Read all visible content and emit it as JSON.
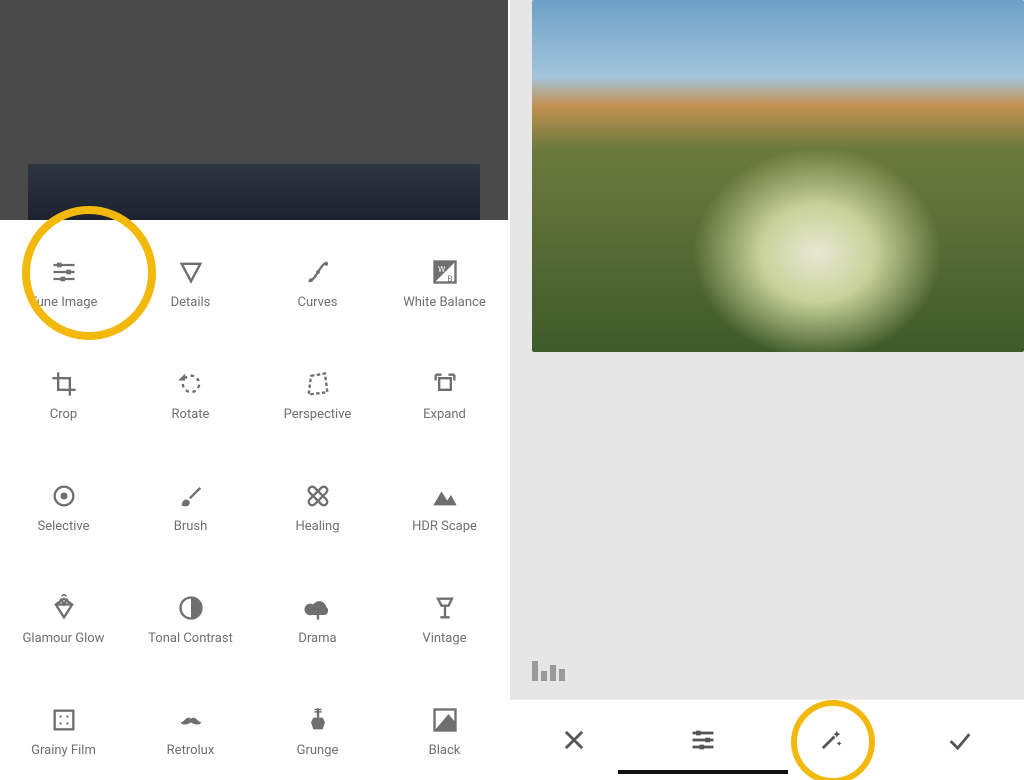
{
  "annotations": {
    "halo_color": "#f2b90c",
    "left_highlighted_tool": "tune-image",
    "right_highlighted_button": "magic-wand"
  },
  "left_pane": {
    "preview": {
      "description": "dark landscape photo preview"
    },
    "tools": [
      {
        "id": "tune-image",
        "label": "Tune Image",
        "icon": "sliders"
      },
      {
        "id": "details",
        "label": "Details",
        "icon": "triangle-down"
      },
      {
        "id": "curves",
        "label": "Curves",
        "icon": "curves"
      },
      {
        "id": "white-balance",
        "label": "White Balance",
        "icon": "wb"
      },
      {
        "id": "crop",
        "label": "Crop",
        "icon": "crop"
      },
      {
        "id": "rotate",
        "label": "Rotate",
        "icon": "rotate"
      },
      {
        "id": "perspective",
        "label": "Perspective",
        "icon": "perspective"
      },
      {
        "id": "expand",
        "label": "Expand",
        "icon": "expand"
      },
      {
        "id": "selective",
        "label": "Selective",
        "icon": "target"
      },
      {
        "id": "brush",
        "label": "Brush",
        "icon": "brush"
      },
      {
        "id": "healing",
        "label": "Healing",
        "icon": "bandage"
      },
      {
        "id": "hdr-scape",
        "label": "HDR Scape",
        "icon": "mountains"
      },
      {
        "id": "glamour-glow",
        "label": "Glamour Glow",
        "icon": "diamond"
      },
      {
        "id": "tonal-contrast",
        "label": "Tonal Contrast",
        "icon": "half-circle"
      },
      {
        "id": "drama",
        "label": "Drama",
        "icon": "cloud"
      },
      {
        "id": "vintage",
        "label": "Vintage",
        "icon": "lamp"
      },
      {
        "id": "grainy-film",
        "label": "Grainy Film",
        "icon": "film"
      },
      {
        "id": "retrolux",
        "label": "Retrolux",
        "icon": "mustache"
      },
      {
        "id": "grunge",
        "label": "Grunge",
        "icon": "guitar"
      },
      {
        "id": "black",
        "label": "Black",
        "icon": "bw"
      }
    ]
  },
  "right_pane": {
    "photo": {
      "description": "flower macro with mountains and sky"
    },
    "histogram_icon": true,
    "toolbar": [
      {
        "id": "cancel",
        "icon": "x",
        "selected": false
      },
      {
        "id": "tune",
        "icon": "sliders",
        "selected": true
      },
      {
        "id": "magic-wand",
        "icon": "wand",
        "selected": false
      },
      {
        "id": "apply",
        "icon": "check",
        "selected": false
      }
    ]
  }
}
